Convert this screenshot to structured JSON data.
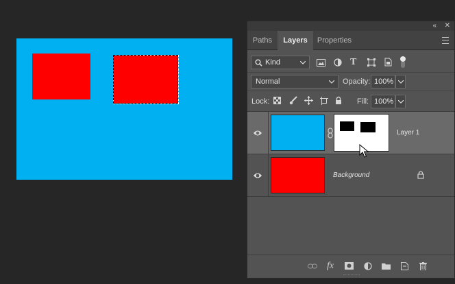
{
  "canvas": {
    "background_color": "#00b0f0",
    "shape_color": "#ff0000"
  },
  "panel": {
    "collapse_glyph": "«",
    "close_glyph": "✕",
    "tabs": [
      {
        "label": "Paths"
      },
      {
        "label": "Layers"
      },
      {
        "label": "Properties"
      }
    ],
    "filter": {
      "kind_label": "Kind"
    },
    "blend": {
      "mode": "Normal",
      "opacity_label": "Opacity:",
      "opacity_value": "100%"
    },
    "lock": {
      "label": "Lock:",
      "fill_label": "Fill:",
      "fill_value": "100%"
    },
    "layers": [
      {
        "name": "Layer 1",
        "selected": true
      },
      {
        "name": "Background",
        "locked": true
      }
    ]
  }
}
